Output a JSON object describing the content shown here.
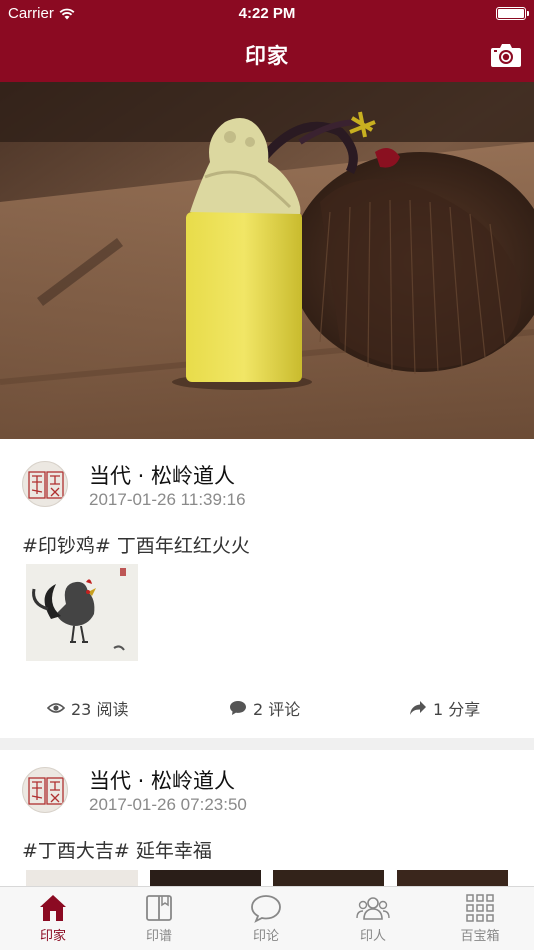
{
  "status_bar": {
    "carrier": "Carrier",
    "time": "4:22 PM"
  },
  "nav": {
    "title": "印家",
    "camera_icon": "camera-icon"
  },
  "posts": [
    {
      "author": "当代 · 松岭道人",
      "time": "2017-01-26 11:39:16",
      "content": "#印钞鸡# 丁酉年红红火火",
      "views": "23 阅读",
      "comments": "2 评论",
      "shares": "1 分享"
    },
    {
      "author": "当代 · 松岭道人",
      "time": "2017-01-26 07:23:50",
      "content": "#丁酉大吉# 延年幸福"
    }
  ],
  "tabs": [
    {
      "label": "印家",
      "icon": "home-icon",
      "active": true
    },
    {
      "label": "印谱",
      "icon": "book-icon",
      "active": false
    },
    {
      "label": "印论",
      "icon": "chat-bubble-icon",
      "active": false
    },
    {
      "label": "印人",
      "icon": "people-icon",
      "active": false
    },
    {
      "label": "百宝箱",
      "icon": "grid-icon",
      "active": false
    }
  ],
  "colors": {
    "brand": "#8b0a22",
    "tab_inactive": "#888888"
  }
}
